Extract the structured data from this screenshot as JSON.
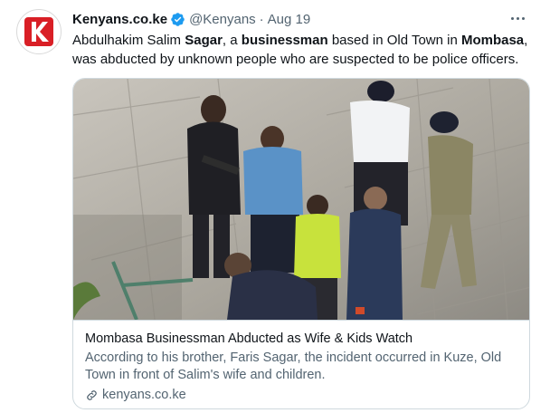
{
  "author": {
    "name": "Kenyans.co.ke",
    "handle": "@Kenyans",
    "separator": "·",
    "date": "Aug 19",
    "avatar_letter": "K",
    "brand_color": "#d91f26"
  },
  "tweet": {
    "segments": [
      {
        "text": "Abdulhakim Salim ",
        "bold": false
      },
      {
        "text": "Sagar",
        "bold": true
      },
      {
        "text": ", a ",
        "bold": false
      },
      {
        "text": "businessman",
        "bold": true
      },
      {
        "text": " based in Old Town in ",
        "bold": false
      },
      {
        "text": "Mombasa",
        "bold": true
      },
      {
        "text": ", was abducted by unknown people who are suspected to be police officers.",
        "bold": false
      }
    ]
  },
  "card": {
    "title": "Mombasa Businessman Abducted as Wife & Kids Watch",
    "description": "According to his brother, Faris Sagar, the incident occurred in Kuze, Old Town in front of Salim's wife and children.",
    "domain": "kenyans.co.ke"
  },
  "icons": {
    "verified": "verified-badge-icon",
    "more": "more-icon",
    "link": "link-icon"
  },
  "colors": {
    "verified": "#1d9bf0",
    "secondary_text": "#536471",
    "border": "#cfd9de"
  }
}
